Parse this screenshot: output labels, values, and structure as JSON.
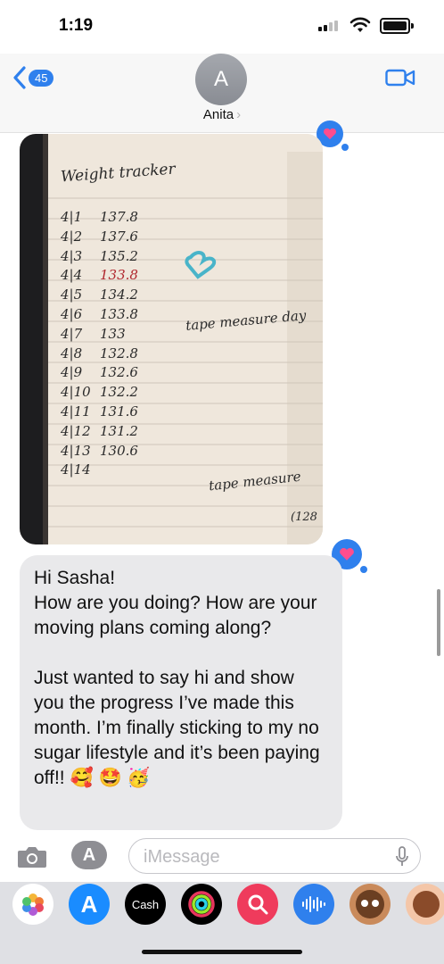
{
  "status_bar": {
    "time": "1:19"
  },
  "header": {
    "back_badge": "45",
    "avatar_initial": "A",
    "contact_name": "Anita",
    "chevron": "›"
  },
  "photo": {
    "title": "Weight tracker",
    "entries": [
      {
        "date": "4|1",
        "weight": "137.8"
      },
      {
        "date": "4|2",
        "weight": "137.6"
      },
      {
        "date": "4|3",
        "weight": "135.2"
      },
      {
        "date": "4|4",
        "weight": "133.8"
      },
      {
        "date": "4|5",
        "weight": "134.2"
      },
      {
        "date": "4|6",
        "weight": "133.8"
      },
      {
        "date": "4|7",
        "weight": "133"
      },
      {
        "date": "4|8",
        "weight": "132.8"
      },
      {
        "date": "4|9",
        "weight": "132.6"
      },
      {
        "date": "4|10",
        "weight": "132.2"
      },
      {
        "date": "4|11",
        "weight": "131.6"
      },
      {
        "date": "4|12",
        "weight": "131.2"
      },
      {
        "date": "4|13",
        "weight": "130.6"
      },
      {
        "date": "4|14",
        "weight": ""
      }
    ],
    "note_1": "tape measure day",
    "note_2": "tape measure",
    "note_3": "(128"
  },
  "message": {
    "text": "Hi Sasha!\nHow are you doing? How are your moving plans coming along?\n\nJust wanted to say hi and show you the progress I’ve made this month. I’m finally sticking to my no sugar lifestyle and it’s been paying off!! 🥰 🤩 🥳"
  },
  "input": {
    "placeholder": "iMessage"
  },
  "apps": [
    {
      "name": "photos-app-icon"
    },
    {
      "name": "app-store-app-icon"
    },
    {
      "name": "cash-app-icon",
      "label": "Cash"
    },
    {
      "name": "activity-app-icon"
    },
    {
      "name": "search-images-app-icon"
    },
    {
      "name": "audio-message-app-icon"
    },
    {
      "name": "memoji-app-icon"
    },
    {
      "name": "memoji-stickers-app-icon"
    }
  ],
  "colors": {
    "accent": "#2f80ed",
    "bubble": "#e9e9eb",
    "drawer": "#dfe0e4"
  }
}
